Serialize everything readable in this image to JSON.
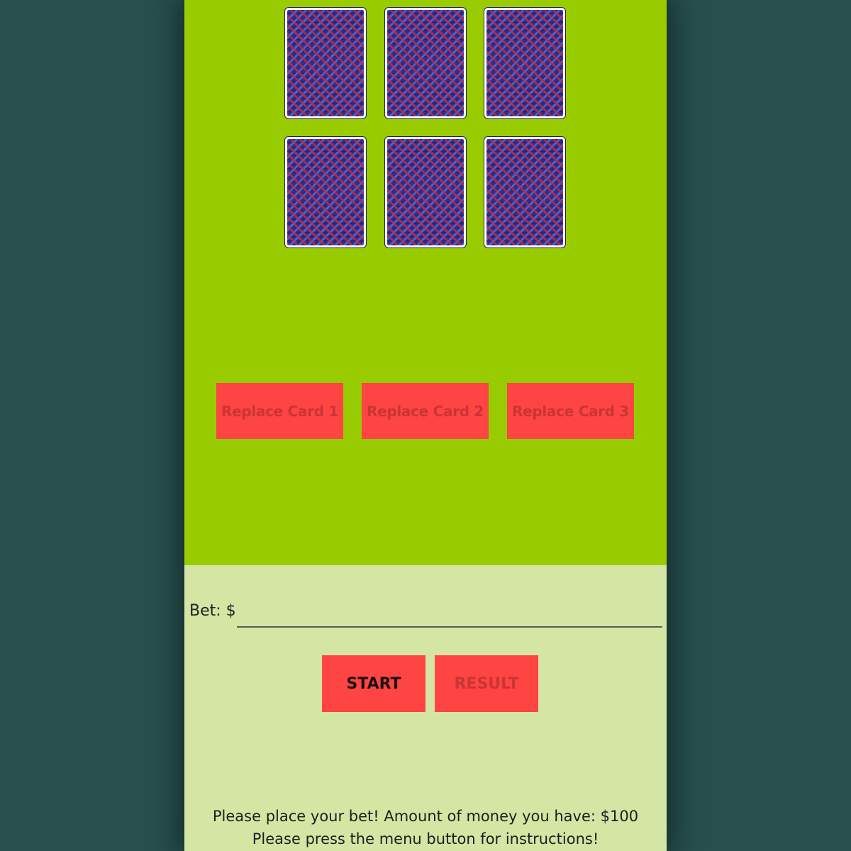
{
  "colors": {
    "outer_background": "#264f4e",
    "table_background": "#99cc00",
    "controls_background": "#d5e5a4",
    "button_background": "#ff4444",
    "disabled_text": "#c93535"
  },
  "cards": [
    {
      "state": "face-down"
    },
    {
      "state": "face-down"
    },
    {
      "state": "face-down"
    },
    {
      "state": "face-down"
    },
    {
      "state": "face-down"
    },
    {
      "state": "face-down"
    }
  ],
  "replace_buttons": [
    {
      "label": "Replace Card 1",
      "enabled": false
    },
    {
      "label": "Replace Card 2",
      "enabled": false
    },
    {
      "label": "Replace Card 3",
      "enabled": false
    }
  ],
  "bet": {
    "label": "Bet: $",
    "value": "",
    "placeholder": ""
  },
  "actions": {
    "start_label": "START",
    "result_label": "RESULT",
    "result_enabled": false
  },
  "status": {
    "line1": "Please place your bet! Amount of money you have: $100",
    "line2": "Please press the menu button for instructions!"
  }
}
